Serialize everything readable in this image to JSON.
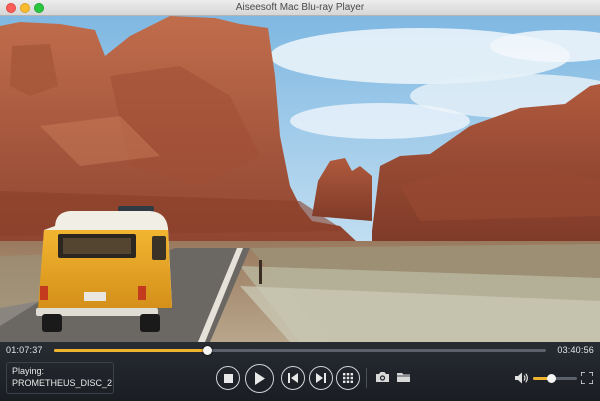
{
  "window": {
    "title": "Aiseesoft Mac Blu-ray Player"
  },
  "player": {
    "current_time": "01:07:37",
    "duration": "03:40:56",
    "progress_fraction": 0.31,
    "volume_fraction": 0.42,
    "now_playing_label": "Playing:",
    "now_playing_title": "PROMETHEUS_DISC_2"
  },
  "colors": {
    "accent": "#f0b32e",
    "control_bar": "#1f2329"
  },
  "icons": {
    "stop": "stop-icon",
    "play": "play-icon",
    "previous": "previous-chapter-icon",
    "next": "next-chapter-icon",
    "menu": "menu-grid-icon",
    "snapshot": "camera-icon",
    "folder": "folder-icon",
    "volume": "speaker-icon",
    "fullscreen": "fullscreen-icon"
  }
}
